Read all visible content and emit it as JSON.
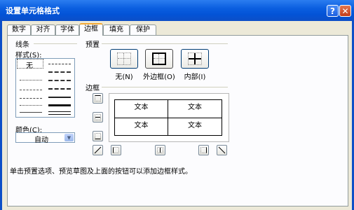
{
  "window": {
    "title": "设置单元格格式",
    "help_glyph": "?",
    "close_glyph": "✕"
  },
  "tabs": [
    "数字",
    "对齐",
    "字体",
    "边框",
    "填充",
    "保护"
  ],
  "active_tab": "边框",
  "line_group": {
    "title": "线条",
    "style_label": "样式(S):",
    "none_label": "无",
    "color_label": "颜色(C):",
    "color_value": "自动"
  },
  "presets": {
    "title": "预置",
    "items": [
      {
        "label": "无(N)",
        "icon": "border-none-icon"
      },
      {
        "label": "外边框(O)",
        "icon": "border-outline-icon"
      },
      {
        "label": "内部(I)",
        "icon": "border-inside-icon"
      }
    ]
  },
  "border": {
    "title": "边框",
    "cells": [
      "文本",
      "文本",
      "文本",
      "文本"
    ]
  },
  "hint": "单击预置选项、预览草图及上面的按钮可以添加边框样式。",
  "colors": {
    "title_bar": "#0a5ee0",
    "active_tab_accent": "#f3a833",
    "panel_bg": "#fcfcfe"
  }
}
